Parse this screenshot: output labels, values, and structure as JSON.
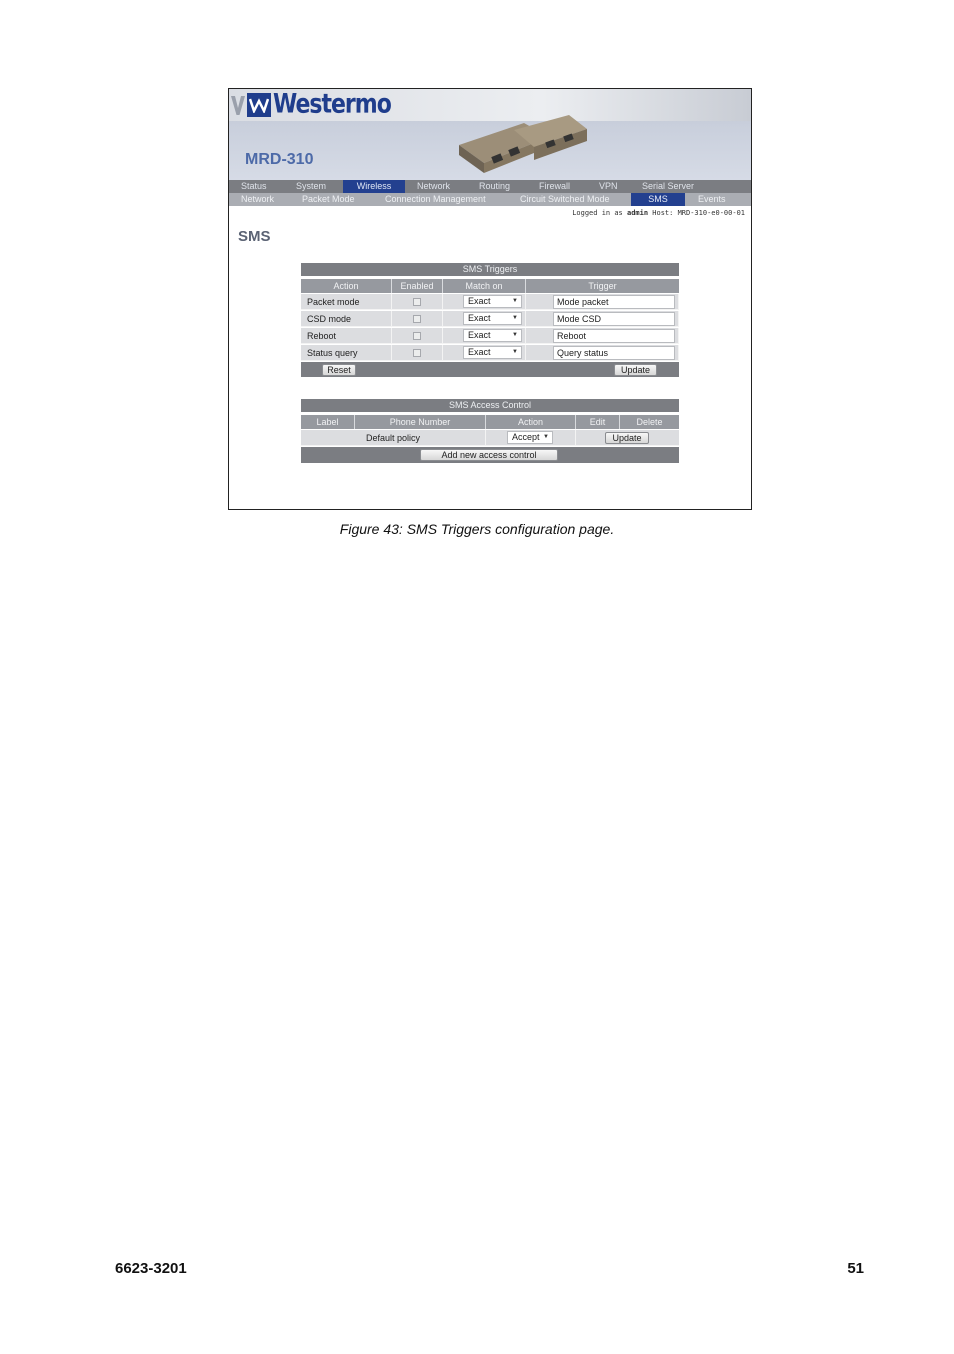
{
  "brand": {
    "logo_text": "Westermo",
    "model": "MRD-310"
  },
  "nav": {
    "main": [
      "Status",
      "System",
      "Wireless",
      "Network",
      "Routing",
      "Firewall",
      "VPN",
      "Serial Server"
    ],
    "main_active": "Wireless",
    "sub": [
      "Network",
      "Packet Mode",
      "Connection Management",
      "Circuit Switched Mode",
      "SMS",
      "Events"
    ],
    "sub_active": "SMS"
  },
  "session": {
    "prefix": "Logged in as",
    "user": "admin",
    "host": "Host: MRD-310-e0-00-01"
  },
  "page_title": "SMS",
  "triggers": {
    "caption": "SMS Triggers",
    "headers": [
      "Action",
      "Enabled",
      "Match on",
      "Trigger"
    ],
    "rows": [
      {
        "action": "Packet mode",
        "enabled": false,
        "match": "Exact",
        "trigger": "Mode packet"
      },
      {
        "action": "CSD mode",
        "enabled": false,
        "match": "Exact",
        "trigger": "Mode CSD"
      },
      {
        "action": "Reboot",
        "enabled": false,
        "match": "Exact",
        "trigger": "Reboot"
      },
      {
        "action": "Status query",
        "enabled": false,
        "match": "Exact",
        "trigger": "Query status"
      }
    ],
    "reset_label": "Reset",
    "update_label": "Update"
  },
  "access": {
    "caption": "SMS Access Control",
    "headers": [
      "Label",
      "Phone Number",
      "Action",
      "Edit",
      "Delete"
    ],
    "default_label": "Default policy",
    "default_action": "Accept",
    "update_label": "Update",
    "add_label": "Add new access control"
  },
  "caption": "Figure 43: SMS Triggers configuration page.",
  "footer": {
    "doc_number": "6623-3201",
    "page_number": "51"
  },
  "colors": {
    "brand_blue": "#1f3d8c",
    "nav_active": "#23408f",
    "table_header": "#7b7d82"
  }
}
